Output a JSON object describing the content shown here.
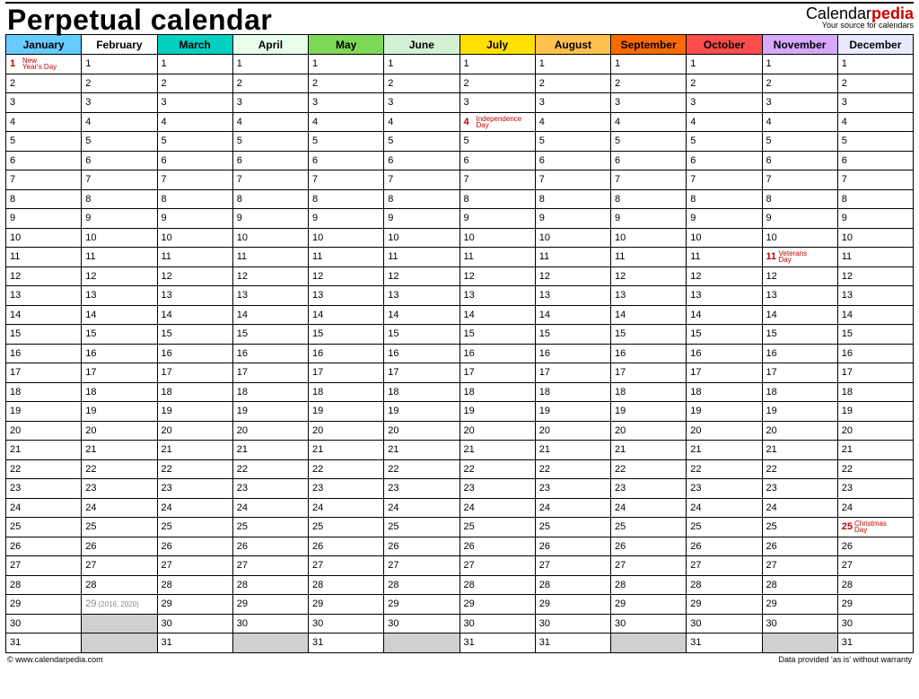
{
  "title": "Perpetual calendar",
  "logo": {
    "part1": "Calendar",
    "part2": "pedia",
    "tagline": "Your source for calendars"
  },
  "months": [
    {
      "name": "January",
      "color": "#66ccff",
      "days": 31
    },
    {
      "name": "February",
      "color": "#ffffff",
      "days": 29
    },
    {
      "name": "March",
      "color": "#00d0c0",
      "days": 31
    },
    {
      "name": "April",
      "color": "#e8ffe8",
      "days": 30
    },
    {
      "name": "May",
      "color": "#7ed957",
      "days": 31
    },
    {
      "name": "June",
      "color": "#d4f0d4",
      "days": 30
    },
    {
      "name": "July",
      "color": "#ffe000",
      "days": 31
    },
    {
      "name": "August",
      "color": "#ffc04d",
      "days": 31
    },
    {
      "name": "September",
      "color": "#ff6a00",
      "days": 30
    },
    {
      "name": "October",
      "color": "#ff4d4d",
      "days": 31
    },
    {
      "name": "November",
      "color": "#d8a8ff",
      "days": 30
    },
    {
      "name": "December",
      "color": "#e8eaff",
      "days": 31
    }
  ],
  "holidays": [
    {
      "month": 0,
      "day": 1,
      "name": "New Year's Day"
    },
    {
      "month": 6,
      "day": 4,
      "name": "Independence Day"
    },
    {
      "month": 10,
      "day": 11,
      "name": "Veterans Day"
    },
    {
      "month": 11,
      "day": 25,
      "name": "Christmas Day"
    }
  ],
  "leap_note": {
    "month": 1,
    "day": 29,
    "text": "(2016, 2020)"
  },
  "footer": {
    "left": "© www.calendarpedia.com",
    "right": "Data provided 'as is' without warranty"
  }
}
